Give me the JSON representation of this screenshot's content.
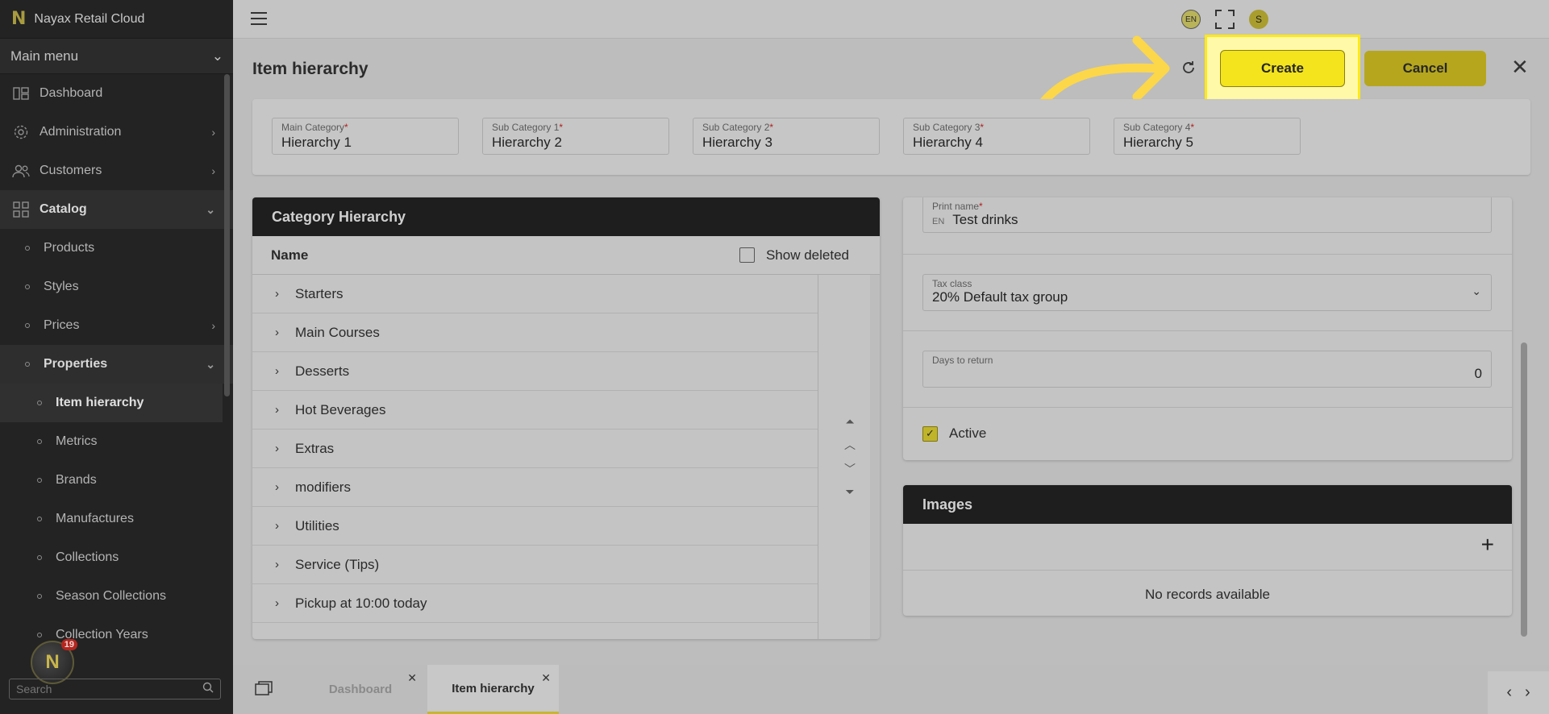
{
  "app": {
    "logo": "N",
    "name": "Nayax Retail Cloud"
  },
  "sidebar": {
    "menu_title": "Main menu",
    "items": [
      {
        "label": "Dashboard",
        "icon": "dashboard-icon",
        "arrow": ""
      },
      {
        "label": "Administration",
        "icon": "gear-icon",
        "arrow": "›"
      },
      {
        "label": "Customers",
        "icon": "users-icon",
        "arrow": "›"
      },
      {
        "label": "Catalog",
        "icon": "grid-icon",
        "arrow": "⌄"
      }
    ],
    "catalog_sub": [
      {
        "label": "Products",
        "arrow": ""
      },
      {
        "label": "Styles",
        "arrow": ""
      },
      {
        "label": "Prices",
        "arrow": "›"
      },
      {
        "label": "Properties",
        "arrow": "⌄"
      }
    ],
    "properties_sub": [
      "Item hierarchy",
      "Metrics",
      "Brands",
      "Manufactures",
      "Collections",
      "Season Collections",
      "Collection Years"
    ],
    "search_placeholder": "Search",
    "notification_count": "19"
  },
  "topbar": {
    "lang": "EN",
    "user_initial": "S"
  },
  "page": {
    "title": "Item hierarchy",
    "create_label": "Create",
    "cancel_label": "Cancel"
  },
  "categories": [
    {
      "label": "Main Category",
      "value": "Hierarchy 1"
    },
    {
      "label": "Sub Category 1",
      "value": "Hierarchy 2"
    },
    {
      "label": "Sub Category 2",
      "value": "Hierarchy 3"
    },
    {
      "label": "Sub Category 3",
      "value": "Hierarchy 4"
    },
    {
      "label": "Sub Category 4",
      "value": "Hierarchy 5"
    }
  ],
  "hierarchy": {
    "title": "Category Hierarchy",
    "column": "Name",
    "show_deleted_label": "Show deleted",
    "rows": [
      "Starters",
      "Main Courses",
      "Desserts",
      "Hot Beverages",
      "Extras",
      "modifiers",
      "Utilities",
      "Service (Tips)",
      "Pickup at 10:00 today"
    ]
  },
  "details": {
    "print_name_label": "Print name",
    "print_name_lang": "EN",
    "print_name_value": "Test drinks",
    "tax_class_label": "Tax class",
    "tax_class_value": "20% Default tax group",
    "days_return_label": "Days to return",
    "days_return_value": "0",
    "active_label": "Active",
    "active_checked": true
  },
  "images": {
    "title": "Images",
    "empty_text": "No records available"
  },
  "tabs": [
    {
      "label": "Dashboard",
      "active": false
    },
    {
      "label": "Item hierarchy",
      "active": true
    }
  ],
  "colors": {
    "accent": "#f3e41e",
    "highlight": "#ffe81a",
    "sidebar": "#232323"
  }
}
